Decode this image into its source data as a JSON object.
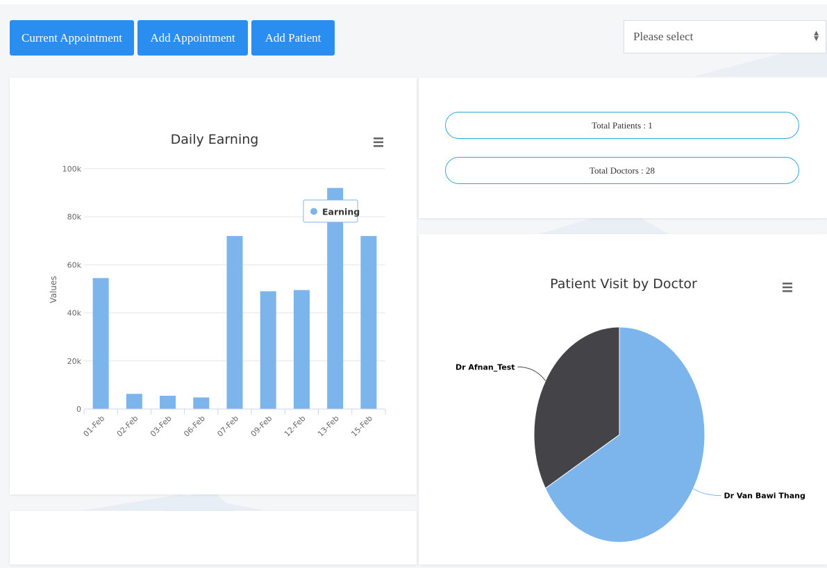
{
  "toolbar": {
    "buttons": [
      "Current Appointment",
      "Add Appointment",
      "Add Patient"
    ],
    "select_value": "Please select"
  },
  "stats": {
    "total_patients": "Total Patients : 1",
    "total_doctors": "Total Doctors : 28"
  },
  "colors": {
    "bar": "#7cb5ec",
    "pie_dark": "#434348",
    "button": "#2a8ef0",
    "pill_border": "#2aa7e0"
  },
  "menu_icon": "hamburger-menu-icon",
  "chart_data": [
    {
      "type": "bar",
      "title": "Daily Earning",
      "ylabel": "Values",
      "categories": [
        "01-Feb",
        "02-Feb",
        "03-Feb",
        "06-Feb",
        "07-Feb",
        "09-Feb",
        "12-Feb",
        "13-Feb",
        "15-Feb"
      ],
      "series": [
        {
          "name": "Earning",
          "values": [
            54500,
            6300,
            5500,
            4800,
            72000,
            49000,
            49500,
            92000,
            72000
          ]
        }
      ],
      "ylim": [
        0,
        100000
      ],
      "yticks": [
        0,
        20000,
        40000,
        60000,
        80000,
        100000
      ],
      "ytick_labels": [
        "0",
        "20k",
        "40k",
        "60k",
        "80k",
        "100k"
      ],
      "grid": true,
      "tooltip": "Earning"
    },
    {
      "type": "pie",
      "title": "Patient Visit by Doctor",
      "labels": [
        "Dr Van Bawi Thang",
        "Dr Afnan_Test"
      ],
      "values": [
        66.7,
        33.3
      ]
    }
  ]
}
